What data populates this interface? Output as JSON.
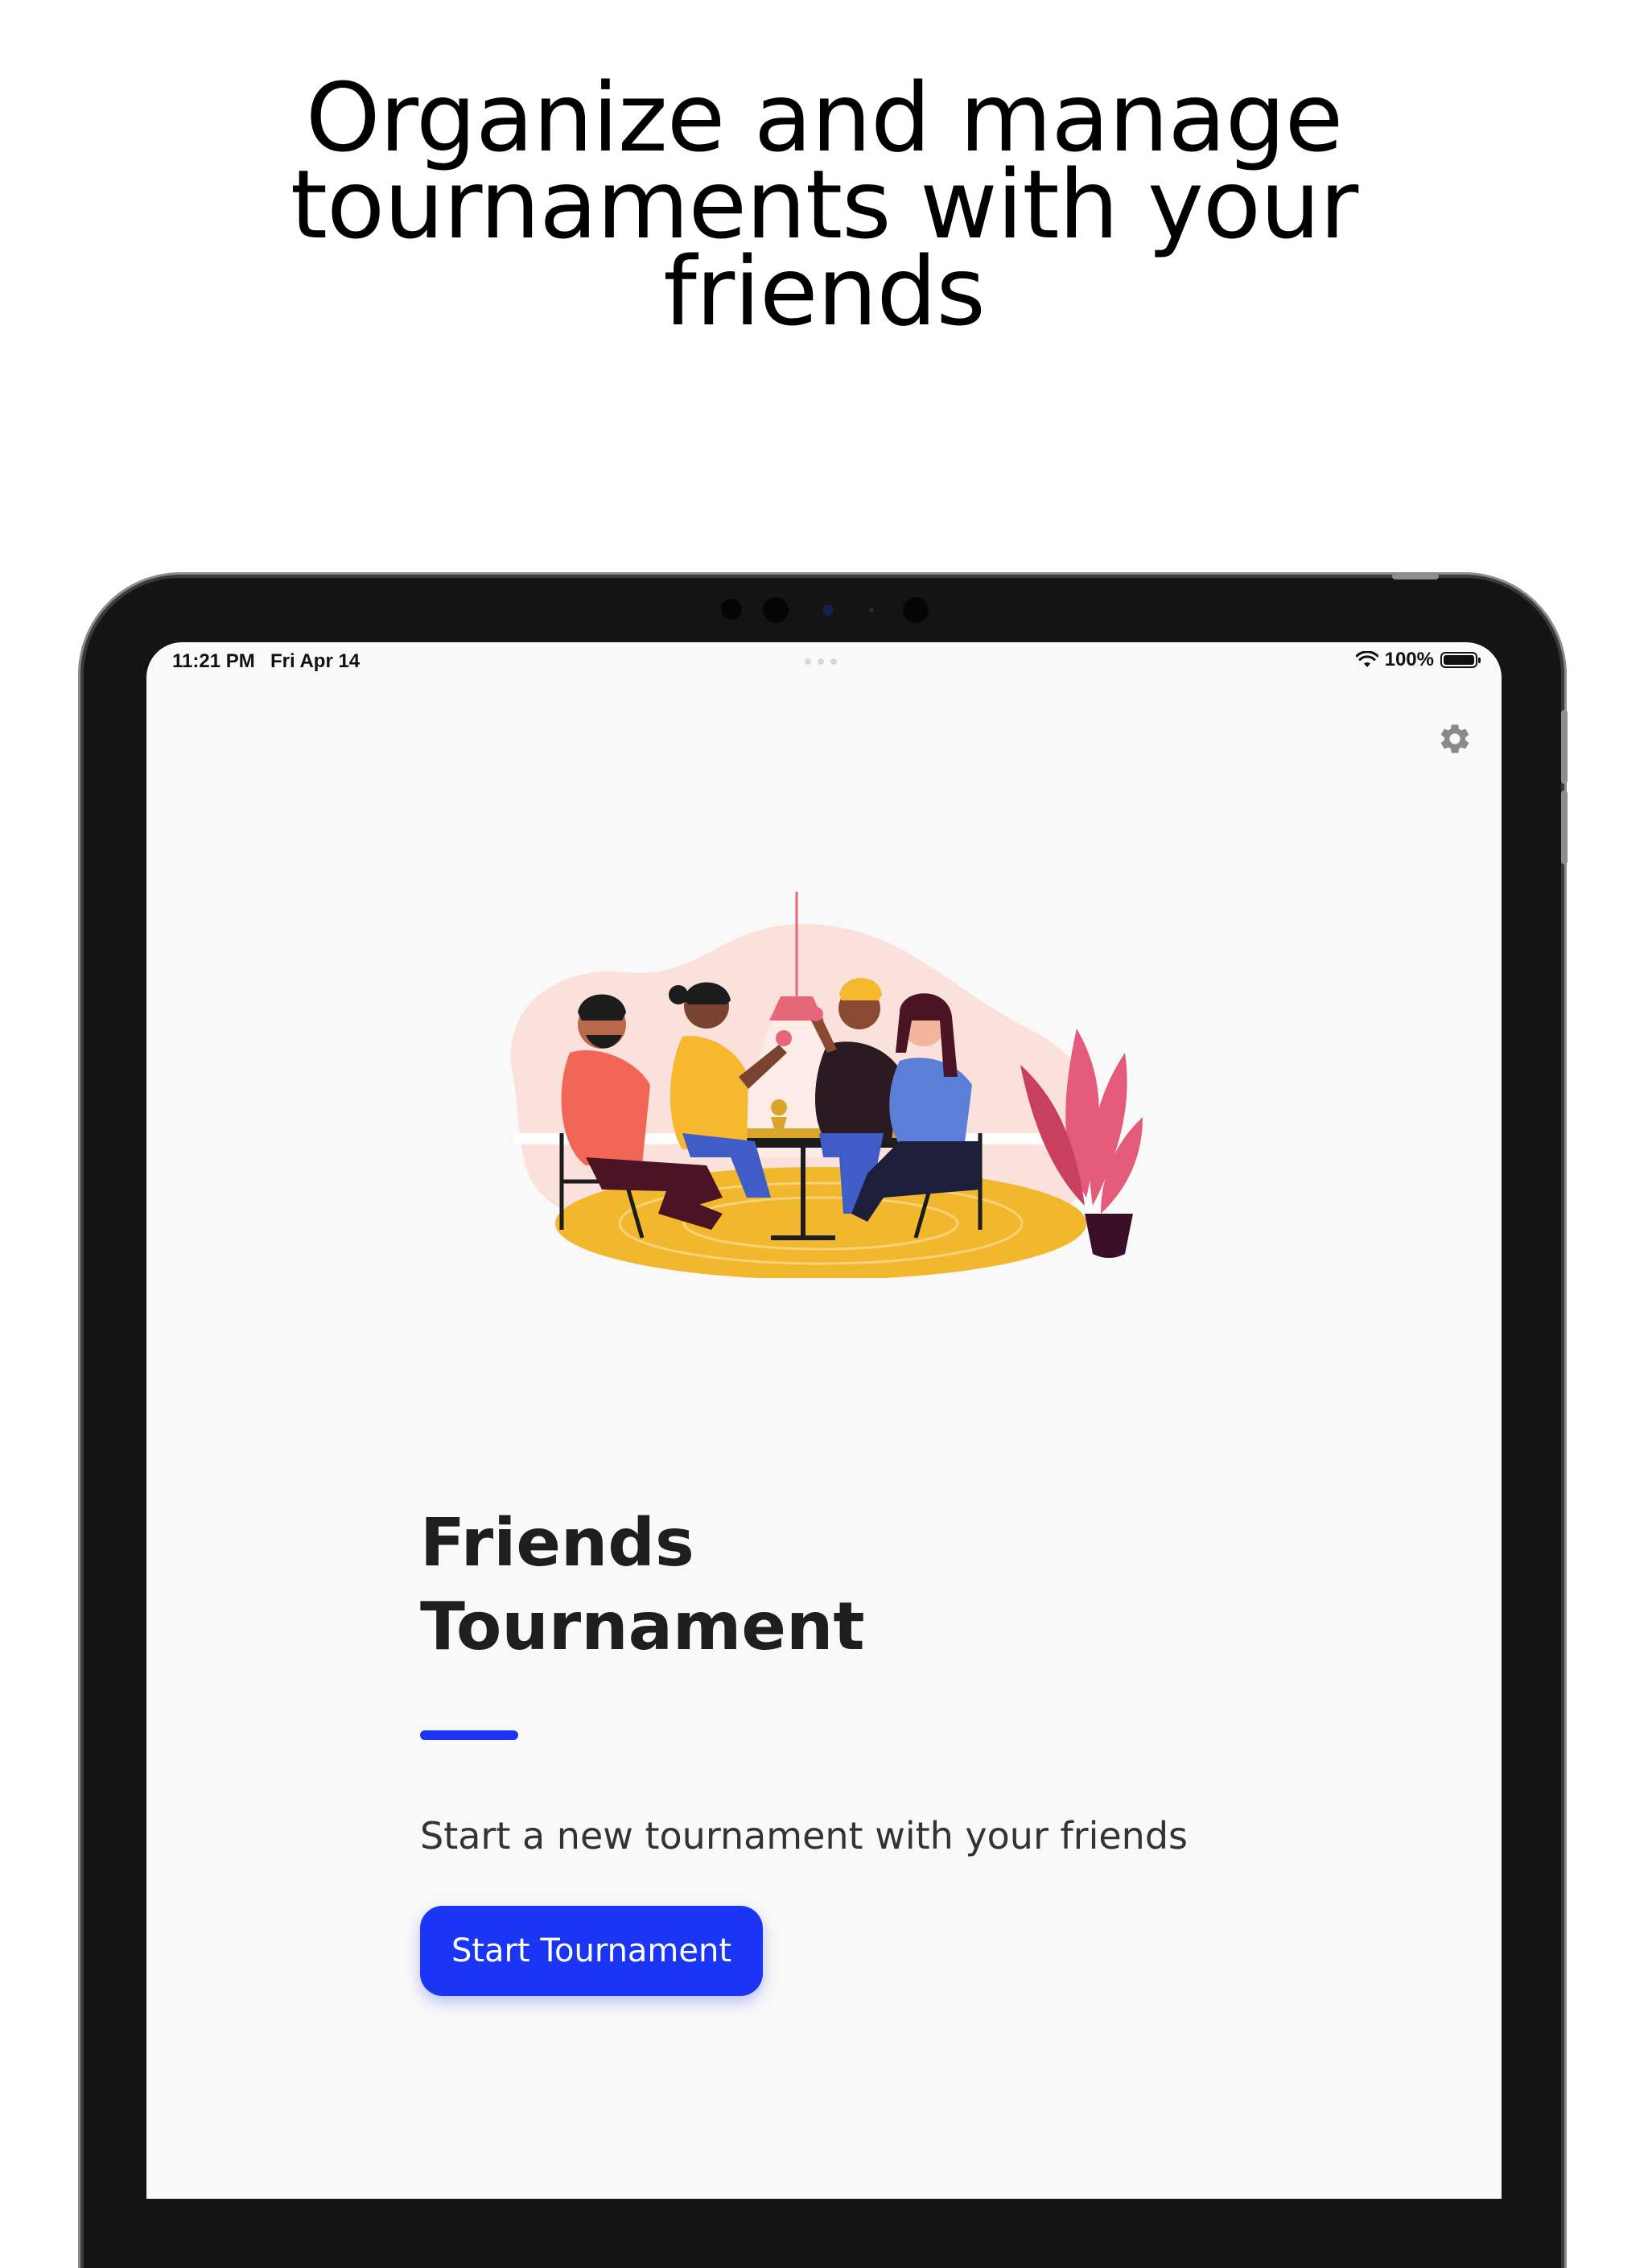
{
  "headline": {
    "line1": "Organize and manage",
    "line2": "tournaments with your",
    "line3": "friends"
  },
  "status_bar": {
    "time": "11:21 PM",
    "date": "Fri Apr 14",
    "battery": "100%",
    "wifi_icon": "wifi-icon",
    "battery_icon": "battery-icon"
  },
  "toolbar": {
    "settings_icon": "gear-icon"
  },
  "illustration": {
    "name": "friends-playing-board-game-illustration"
  },
  "main": {
    "title_line1": "Friends",
    "title_line2": "Tournament",
    "subtitle": "Start a new tournament with your friends",
    "start_button_label": "Start Tournament"
  },
  "colors": {
    "accent": "#1b35f5",
    "background": "#f9f9f9",
    "bezel": "#141414"
  }
}
